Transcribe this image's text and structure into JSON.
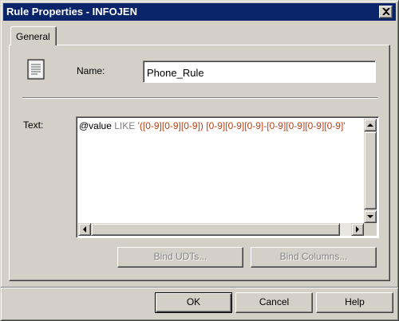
{
  "window": {
    "title": "Rule Properties - INFOJEN",
    "close_icon": "close-icon"
  },
  "tabs": [
    {
      "label": "General",
      "selected": true
    }
  ],
  "general": {
    "rule_icon": "rule-document-icon",
    "name_label": "Name:",
    "name_value": "Phone_Rule",
    "text_label": "Text:",
    "text_tokens": {
      "var": "@value",
      "keyword": "LIKE",
      "pattern": "'([0-9][0-9][0-9]) [0-9][0-9][0-9]-[0-9][0-9][0-9][0-9]'"
    },
    "bind_udts_label": "Bind UDTs...",
    "bind_columns_label": "Bind Columns..."
  },
  "footer": {
    "ok_label": "OK",
    "cancel_label": "Cancel",
    "help_label": "Help"
  },
  "colors": {
    "titlebar": "#0a246a",
    "face": "#d4d0c8",
    "keyword": "#808080",
    "string_literal": "#c04010"
  }
}
